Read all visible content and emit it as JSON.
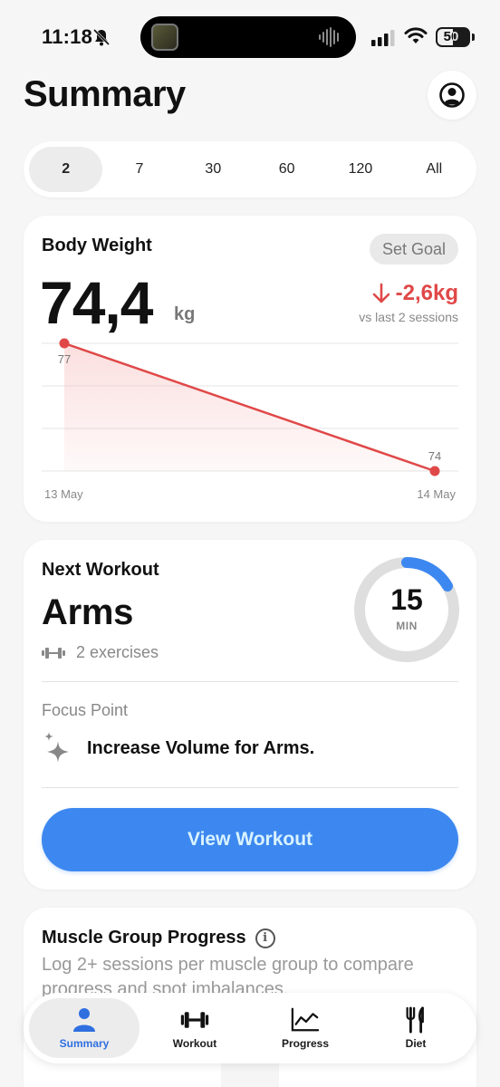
{
  "status": {
    "time": "11:18",
    "battery": "50"
  },
  "header": {
    "title": "Summary"
  },
  "range": {
    "options": [
      "2",
      "7",
      "30",
      "60",
      "120",
      "All"
    ],
    "selected": "2"
  },
  "body_weight": {
    "label": "Body Weight",
    "goal_button": "Set Goal",
    "value": "74,4",
    "unit": "kg",
    "delta": "-2,6kg",
    "delta_sub": "vs last 2 sessions"
  },
  "chart_data": {
    "type": "area",
    "x": [
      "13 May",
      "14 May"
    ],
    "values": [
      77,
      74
    ],
    "data_labels": [
      "77",
      "74"
    ],
    "ylim": [
      74,
      77
    ],
    "grid": true,
    "color": "#e04848"
  },
  "next_workout": {
    "label": "Next Workout",
    "name": "Arms",
    "exercises": "2 exercises",
    "duration": "15",
    "duration_unit": "MIN",
    "focus_label": "Focus Point",
    "focus_text": "Increase Volume for Arms.",
    "button": "View Workout"
  },
  "muscle_group": {
    "label": "Muscle Group Progress",
    "description": "Log 2+ sessions per muscle group to compare progress and spot imbalances."
  },
  "tabs": [
    {
      "label": "Summary",
      "icon": "person-icon"
    },
    {
      "label": "Workout",
      "icon": "dumbbell-icon"
    },
    {
      "label": "Progress",
      "icon": "chart-icon"
    },
    {
      "label": "Diet",
      "icon": "fork-knife-icon"
    }
  ],
  "colors": {
    "accent": "#3d88f0",
    "negative": "#e04848"
  }
}
